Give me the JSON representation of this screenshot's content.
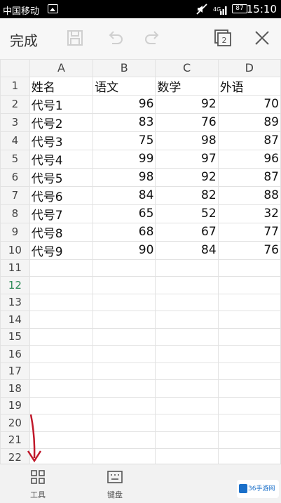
{
  "status_bar": {
    "carrier": "中国移动",
    "battery": "87",
    "time": "15:10"
  },
  "toolbar": {
    "done_label": "完成",
    "sheet_count": "2"
  },
  "spreadsheet": {
    "column_headers": [
      "A",
      "B",
      "C",
      "D"
    ],
    "active_row": 12,
    "rows": [
      {
        "row": "1",
        "a": "姓名",
        "b": "语文",
        "c": "数学",
        "d": "外语"
      },
      {
        "row": "2",
        "a": "代号1",
        "b": "96",
        "c": "92",
        "d": "70"
      },
      {
        "row": "3",
        "a": "代号2",
        "b": "83",
        "c": "76",
        "d": "89"
      },
      {
        "row": "4",
        "a": "代号3",
        "b": "75",
        "c": "98",
        "d": "87"
      },
      {
        "row": "5",
        "a": "代号4",
        "b": "99",
        "c": "97",
        "d": "96"
      },
      {
        "row": "6",
        "a": "代号5",
        "b": "98",
        "c": "92",
        "d": "87"
      },
      {
        "row": "7",
        "a": "代号6",
        "b": "84",
        "c": "82",
        "d": "88"
      },
      {
        "row": "8",
        "a": "代号7",
        "b": "65",
        "c": "52",
        "d": "32"
      },
      {
        "row": "9",
        "a": "代号8",
        "b": "68",
        "c": "67",
        "d": "77"
      },
      {
        "row": "10",
        "a": "代号9",
        "b": "90",
        "c": "84",
        "d": "76"
      },
      {
        "row": "11",
        "a": "",
        "b": "",
        "c": "",
        "d": ""
      },
      {
        "row": "12",
        "a": "",
        "b": "",
        "c": "",
        "d": ""
      },
      {
        "row": "13",
        "a": "",
        "b": "",
        "c": "",
        "d": ""
      },
      {
        "row": "14",
        "a": "",
        "b": "",
        "c": "",
        "d": ""
      },
      {
        "row": "15",
        "a": "",
        "b": "",
        "c": "",
        "d": ""
      },
      {
        "row": "16",
        "a": "",
        "b": "",
        "c": "",
        "d": ""
      },
      {
        "row": "17",
        "a": "",
        "b": "",
        "c": "",
        "d": ""
      },
      {
        "row": "18",
        "a": "",
        "b": "",
        "c": "",
        "d": ""
      },
      {
        "row": "19",
        "a": "",
        "b": "",
        "c": "",
        "d": ""
      },
      {
        "row": "20",
        "a": "",
        "b": "",
        "c": "",
        "d": ""
      },
      {
        "row": "21",
        "a": "",
        "b": "",
        "c": "",
        "d": ""
      },
      {
        "row": "22",
        "a": "",
        "b": "",
        "c": "",
        "d": ""
      }
    ]
  },
  "bottom_bar": {
    "tools_label": "工具",
    "keyboard_label": "键盘"
  },
  "watermark": {
    "text": "36手游网"
  },
  "colors": {
    "active_row_number": "#2e8b57",
    "arrow": "#c0182a",
    "watermark": "#1a6fc9"
  }
}
